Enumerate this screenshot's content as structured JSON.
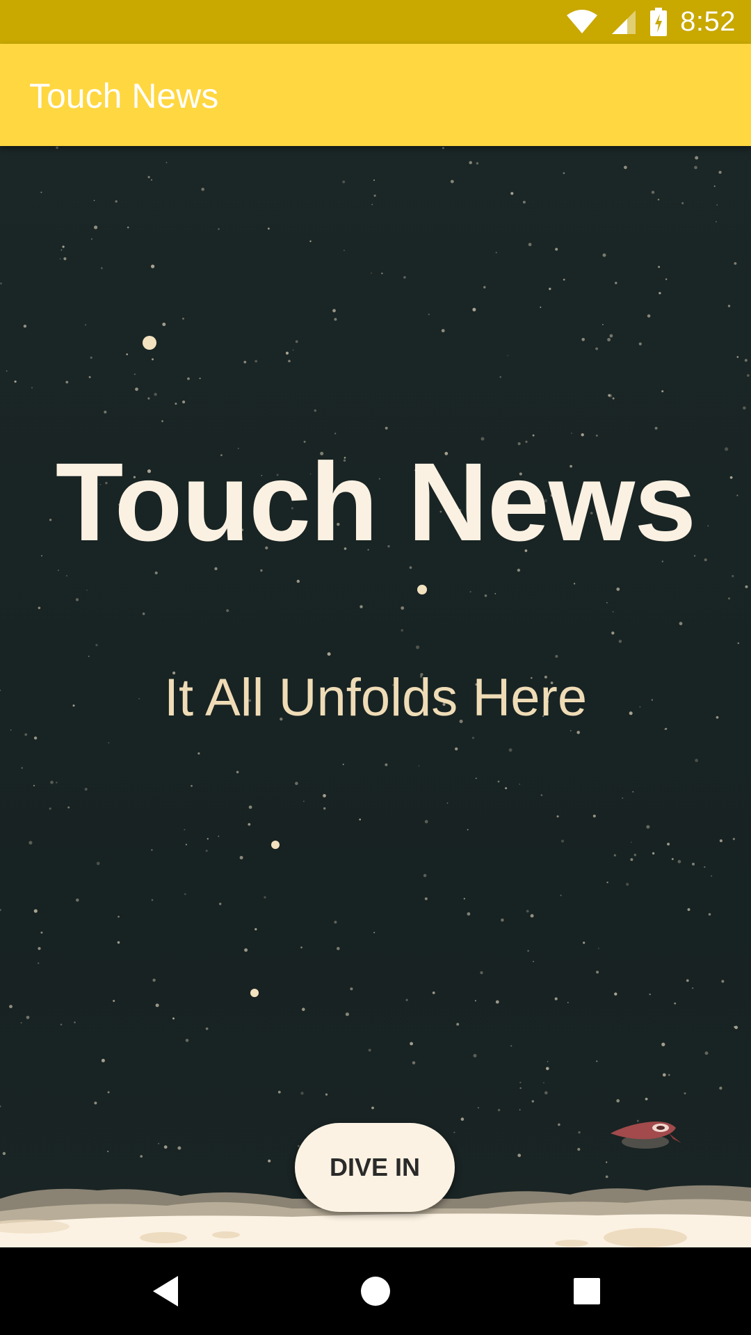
{
  "status_bar": {
    "time": "8:52",
    "icons": [
      "wifi-icon",
      "cell-signal-icon",
      "battery-charging-icon"
    ]
  },
  "app_bar": {
    "title": "Touch News"
  },
  "hero": {
    "title": "Touch News",
    "subtitle": "It All Unfolds Here"
  },
  "cta": {
    "label": "DIVE IN"
  },
  "nav_bar": {
    "icons": [
      "back-icon",
      "home-icon",
      "recents-icon"
    ]
  },
  "colors": {
    "status_bar": "#c9a800",
    "app_bar": "#ffd740",
    "background": "#1b2626",
    "hero_text": "#fbf1e2",
    "subtitle_text": "#efdcb6",
    "button": "#fcf2e3"
  }
}
